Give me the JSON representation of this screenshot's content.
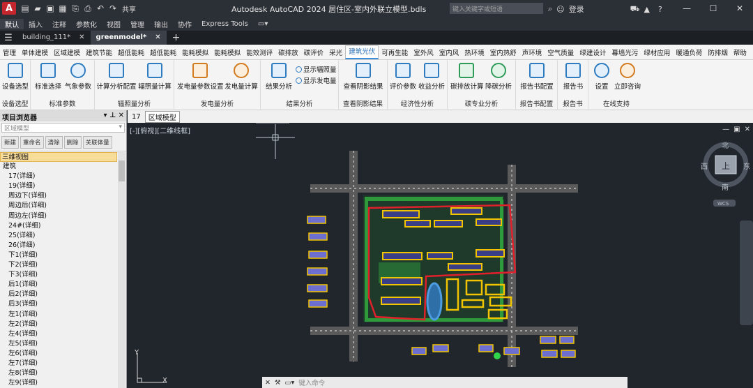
{
  "titlebar": {
    "logo": "A",
    "share_label": "共享",
    "title": "Autodesk AutoCAD 2024  居住区-室内外联立模型.bdls",
    "search_placeholder": "键入关键字或短语",
    "login_label": "登录",
    "help_label": "?"
  },
  "menubar": [
    "默认",
    "插入",
    "注释",
    "参数化",
    "视图",
    "管理",
    "输出",
    "协作",
    "Express Tools"
  ],
  "filetabs": [
    {
      "label": "building_111*",
      "active": false
    },
    {
      "label": "greenmodel*",
      "active": true
    }
  ],
  "ribbon_tabs": [
    "管理",
    "单体建模",
    "区域建模",
    "建筑节能",
    "超低能耗",
    "超低能耗",
    "能耗模拟",
    "能耗模拟",
    "能效测评",
    "碳排放",
    "碳评价",
    "采光",
    "建筑光伏",
    "可再生能",
    "室外风",
    "室内风",
    "热环境",
    "室内热舒",
    "声环境",
    "空气质量",
    "绿建设计",
    "幕墙光污",
    "绿材应用",
    "暖通负荷",
    "防排烟",
    "帮助"
  ],
  "ribbon_active_index": 12,
  "ribbon_groups": [
    {
      "title": "设备选型",
      "buttons": [
        "设备选型"
      ]
    },
    {
      "title": "标准参数",
      "buttons": [
        "标准选择",
        "气象参数"
      ]
    },
    {
      "title": "辐照量分析",
      "buttons": [
        "计算分析配置",
        "辐照量计算"
      ]
    },
    {
      "title": "发电量分析",
      "buttons": [
        "发电量参数设置",
        "发电量计算"
      ]
    },
    {
      "title": "结果分析",
      "buttons": [
        "结果分析"
      ],
      "small": [
        "显示辐照量",
        "显示发电量"
      ]
    },
    {
      "title": "查看阴影结果",
      "buttons": [
        "查看阴影结果"
      ]
    },
    {
      "title": "经济性分析",
      "buttons": [
        "评价参数",
        "收益分析"
      ]
    },
    {
      "title": "碳专业分析",
      "buttons": [
        "碳排放计算",
        "降碳分析"
      ]
    },
    {
      "title": "报告书配置",
      "buttons": [
        "报告书配置"
      ]
    },
    {
      "title": "报告书",
      "buttons": [
        "报告书"
      ]
    },
    {
      "title": "在线支持",
      "buttons": [
        "设置",
        "立即咨询"
      ]
    }
  ],
  "sidebar": {
    "title": "项目浏览器",
    "select_value": "区域模型",
    "buttons": [
      "新建",
      "重命名",
      "清除",
      "删除",
      "关联体量"
    ],
    "tree": [
      "三维视图",
      "建筑",
      "17(详细)",
      "19(详细)",
      "周边下(详细)",
      "周边后(详细)",
      "周边左(详细)",
      "24#(详细)",
      "25(详细)",
      "26(详细)",
      "下1(详细)",
      "下2(详细)",
      "下3(详细)",
      "后1(详细)",
      "后2(详细)",
      "后3(详细)",
      "左1(详细)",
      "左2(详细)",
      "左4(详细)",
      "左5(详细)",
      "左6(详细)",
      "左7(详细)",
      "左8(详细)",
      "左9(详细)"
    ]
  },
  "doctabs": {
    "num": "17",
    "tab": "区域模型"
  },
  "viewport": {
    "label": "[-][俯视][二维线框]",
    "compass": {
      "north": "北",
      "south": "南",
      "east": "东",
      "west": "西",
      "center": "上",
      "wcs": "WCS"
    }
  },
  "cmdline": {
    "placeholder": "键入命令"
  },
  "colors": {
    "accent": "#3c8fd8",
    "boundary": "#e0202a",
    "building": "#f2c400",
    "road": "#5a5a5a"
  }
}
